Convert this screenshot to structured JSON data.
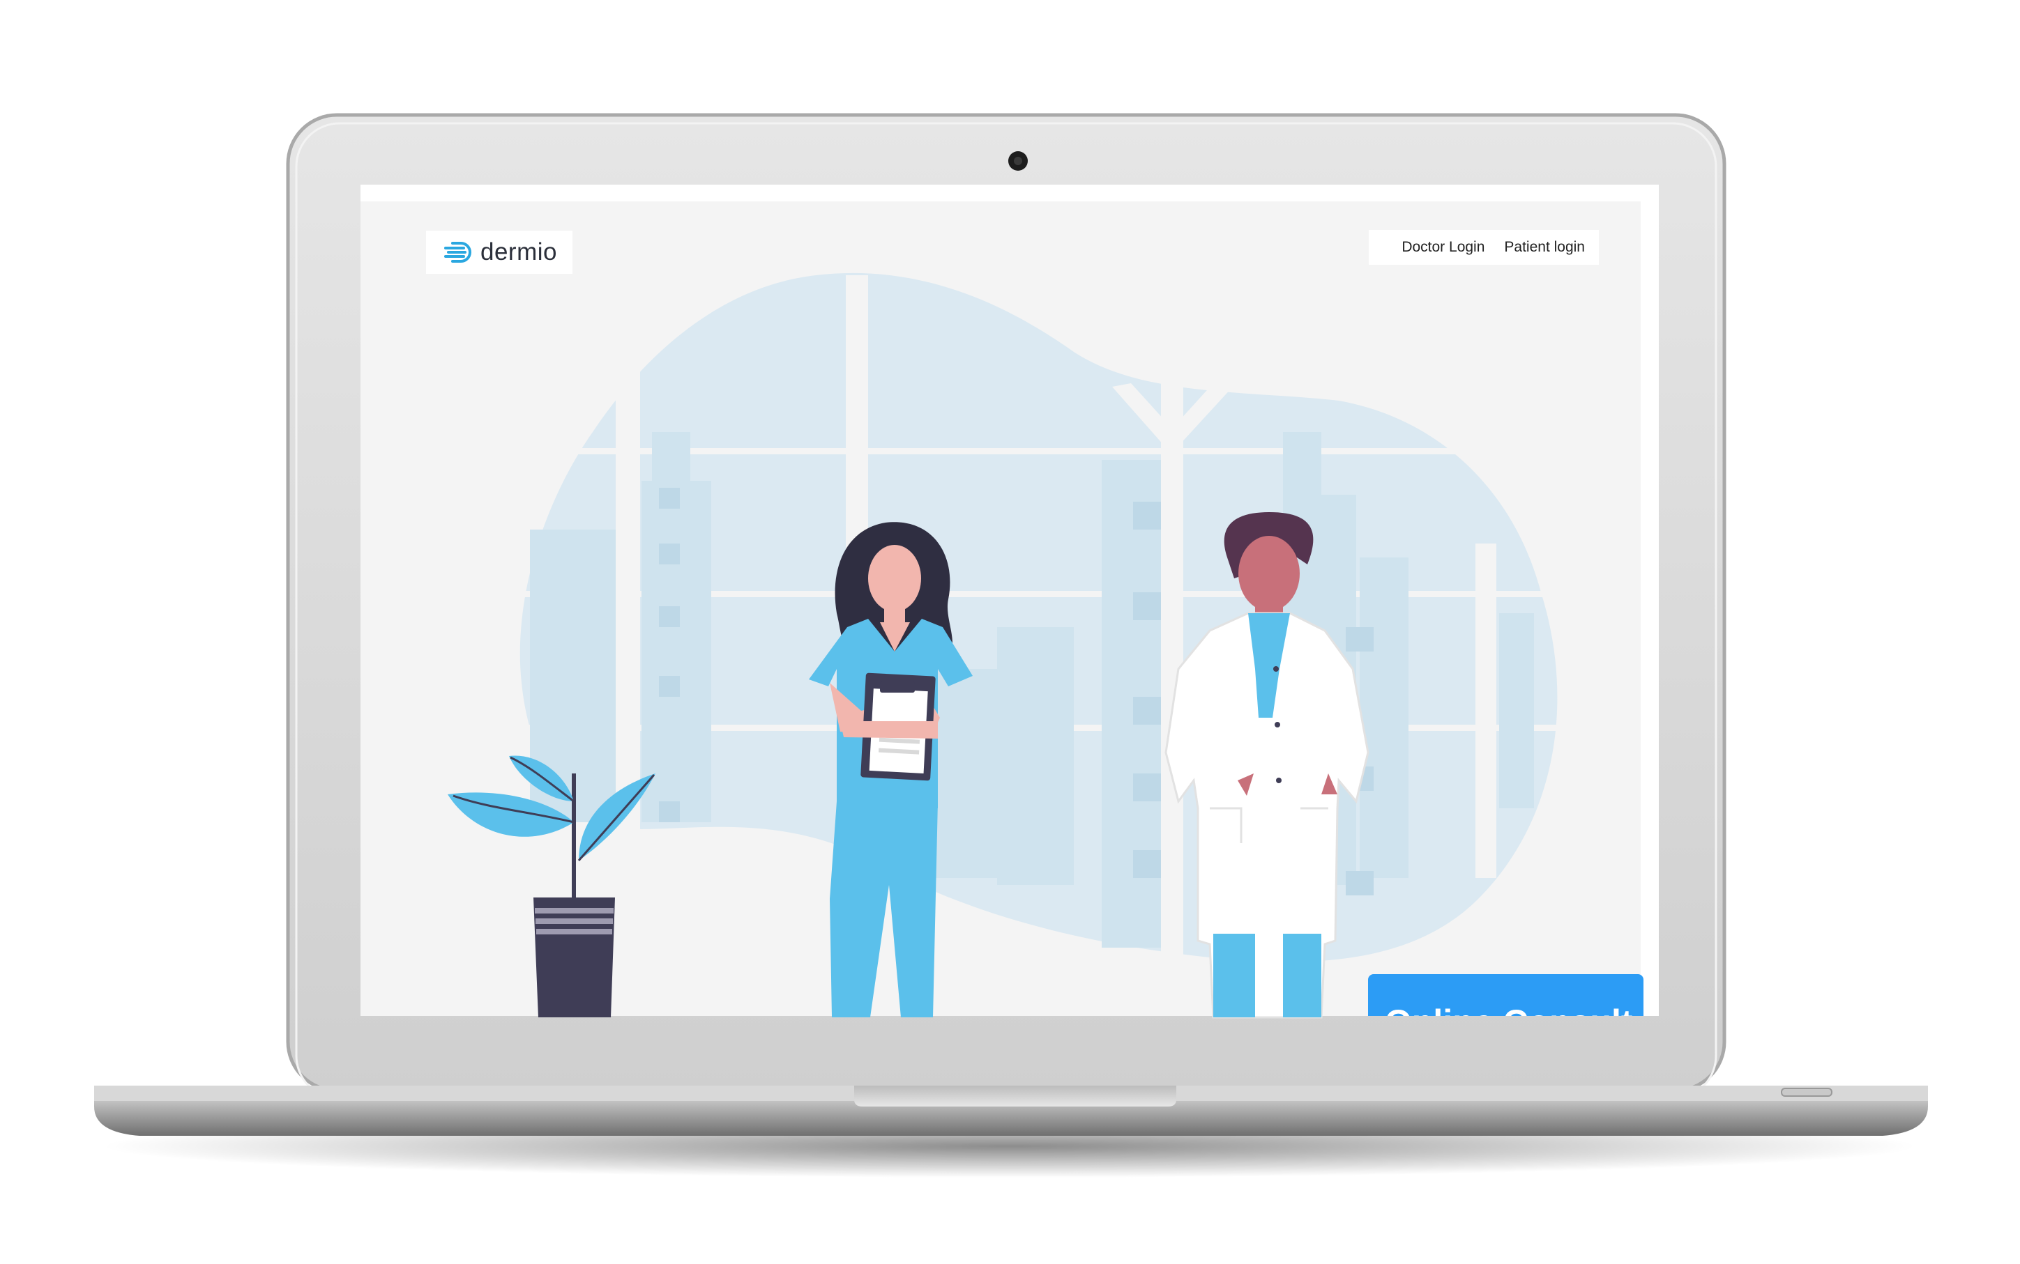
{
  "brand": {
    "name": "dermio",
    "accent": "#2aa7e0"
  },
  "nav": {
    "doctor_login": "Doctor Login",
    "patient_login": "Patient login"
  },
  "cta": {
    "label": "Online Consult",
    "color": "#2c9cf5"
  },
  "icons": {
    "logo": "speed-lines-d-icon",
    "webcam": "camera-icon"
  },
  "colors": {
    "page_background": "#f4f4f4",
    "illustration_blob": "#dbe9f2",
    "scrubs": "#5bc0eb",
    "plant_pot": "#3f3d56"
  }
}
